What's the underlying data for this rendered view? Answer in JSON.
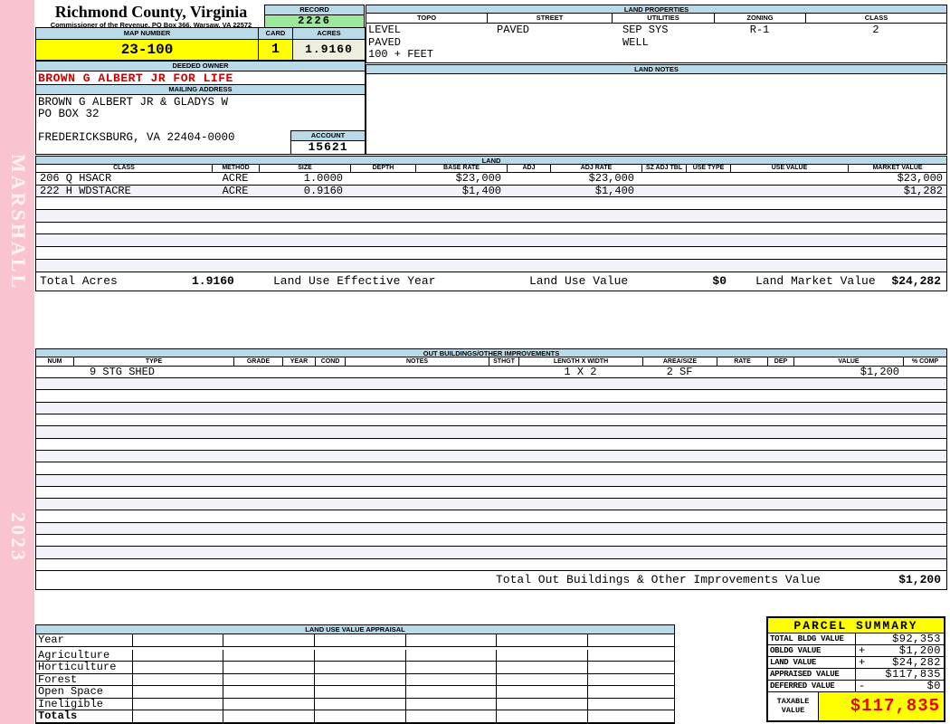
{
  "watermarks": {
    "name": "MARSHALL",
    "year": "2023"
  },
  "header": {
    "county": "Richmond County, Virginia",
    "subtitle": "Commissioner of the Revenue, PO Box 366, Warsaw, VA 22572"
  },
  "record": {
    "label": "RECORD",
    "value": "2226"
  },
  "map_bar": {
    "map_number_label": "MAP NUMBER",
    "map_number": "23-100",
    "card_label": "CARD",
    "card": "1",
    "acres_label": "ACRES",
    "acres": "1.9160"
  },
  "land_properties": {
    "title": "LAND PROPERTIES",
    "columns": [
      "TOPO",
      "STREET",
      "UTILITIES",
      "ZONING",
      "CLASS"
    ],
    "values": [
      [
        "LEVEL",
        "PAVED",
        "100 + FEET"
      ],
      [
        "PAVED"
      ],
      [
        "SEP SYS",
        "WELL"
      ],
      [
        "R-1"
      ],
      [
        "2"
      ]
    ]
  },
  "owner": {
    "deeded_owner_label": "DEEDED OWNER",
    "deeded_owner": "BROWN G ALBERT JR FOR LIFE",
    "mailing_label": "MAILING ADDRESS",
    "mailing_lines": [
      "BROWN G ALBERT JR & GLADYS W",
      "PO BOX 32",
      "",
      "FREDERICKSBURG, VA 22404-0000"
    ],
    "account_label": "ACCOUNT",
    "account": "15621"
  },
  "land_notes": {
    "title": "LAND NOTES",
    "text": ""
  },
  "land_table": {
    "title": "LAND",
    "columns": [
      "CLASS",
      "METHOD",
      "SIZE",
      "DEPTH",
      "BASE RATE",
      "ADJ",
      "ADJ RATE",
      "SZ ADJ TBL",
      "USE TYPE",
      "USE VALUE",
      "MARKET VALUE"
    ],
    "rows": [
      {
        "class": "206 Q HSACR",
        "method": "ACRE",
        "size": "1.0000",
        "depth": "",
        "base_rate": "$23,000",
        "adj": "",
        "adj_rate": "$23,000",
        "sz_adj_tbl": "",
        "use_type": "",
        "use_value": "",
        "market_value": "$23,000"
      },
      {
        "class": "222 H WDSTACRE",
        "method": "ACRE",
        "size": "0.9160",
        "depth": "",
        "base_rate": "$1,400",
        "adj": "",
        "adj_rate": "$1,400",
        "sz_adj_tbl": "",
        "use_type": "",
        "use_value": "",
        "market_value": "$1,282"
      }
    ],
    "empty_row_count": 6,
    "totals": {
      "total_acres_label": "Total Acres",
      "total_acres": "1.9160",
      "effective_year_label": "Land Use Effective Year",
      "use_value_label": "Land Use Value",
      "use_value": "$0",
      "market_value_label": "Land Market Value",
      "market_value": "$24,282"
    }
  },
  "out_buildings": {
    "title": "OUT BUILDINGS/OTHER IMPROVEMENTS",
    "columns": [
      "NUM",
      "TYPE",
      "GRADE",
      "YEAR",
      "COND",
      "NOTES",
      "STHGT",
      "LENGTH X WIDTH",
      "AREA/SIZE",
      "RATE",
      "DEP",
      "VALUE",
      "% COMP"
    ],
    "rows": [
      {
        "num": "",
        "type": "9 STG SHED",
        "grade": "",
        "year": "",
        "cond": "",
        "notes": "",
        "sthgt": "",
        "length_x_width": "1 X 2",
        "area_size": "2 SF",
        "rate": "",
        "dep": "",
        "value": "$1,200",
        "pct_comp": ""
      }
    ],
    "empty_row_count": 16,
    "total_label": "Total Out Buildings & Other Improvements Value",
    "total_value": "$1,200"
  },
  "land_use_appraisal": {
    "title": "LAND USE VALUE APPRAISAL",
    "row_labels": [
      "Year",
      "Agriculture",
      "Horticulture",
      "Forest",
      "Open Space",
      "Ineligible",
      "Totals"
    ],
    "column_count": 6
  },
  "parcel_summary": {
    "title": "PARCEL SUMMARY",
    "rows": [
      {
        "label": "TOTAL BLDG VALUE",
        "sign": "",
        "value": "$92,353"
      },
      {
        "label": "OBLDG VALUE",
        "sign": "+",
        "value": "$1,200"
      },
      {
        "label": "LAND VALUE",
        "sign": "+",
        "value": "$24,282"
      },
      {
        "label": "APPRAISED VALUE",
        "sign": "",
        "value": "$117,835"
      },
      {
        "label": "DEFERRED VALUE",
        "sign": "-",
        "value": "$0"
      }
    ],
    "taxable_label": "TAXABLE\nVALUE",
    "taxable_value": "$117,835"
  },
  "colors": {
    "pink": "#F9C4CF",
    "cyan": "#B9DAE9",
    "green": "#9BE79B",
    "yellow": "#FFFF00",
    "beige": "#EFEFDF",
    "alt_row": "#F2F2FA",
    "owner_red": "#CC0000",
    "taxable_red": "#EE0000"
  }
}
